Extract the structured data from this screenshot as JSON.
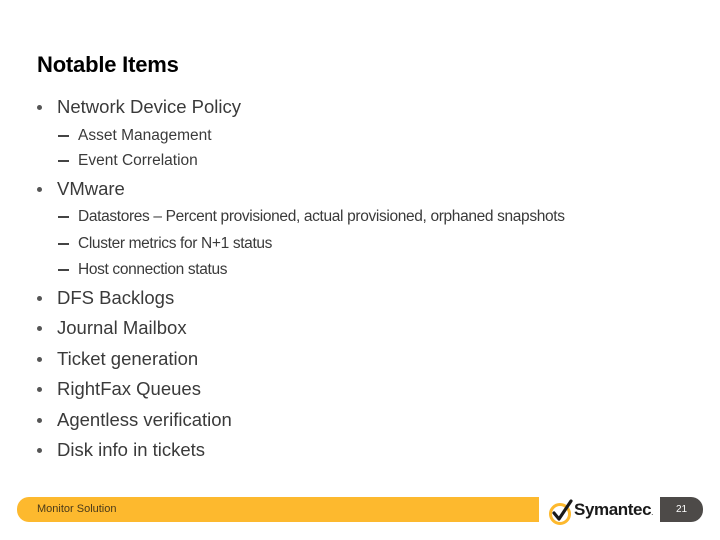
{
  "slide": {
    "title": "Notable Items",
    "items": [
      {
        "label": "Network Device Policy",
        "subitems": [
          "Asset Management",
          "Event Correlation"
        ]
      },
      {
        "label": "VMware",
        "subitems": [
          "Datastores – Percent provisioned, actual provisioned, orphaned snapshots",
          "Cluster metrics for N+1 status",
          "Host connection status"
        ]
      },
      {
        "label": "DFS Backlogs",
        "subitems": []
      },
      {
        "label": "Journal Mailbox",
        "subitems": []
      },
      {
        "label": "Ticket generation",
        "subitems": []
      },
      {
        "label": "RightFax Queues",
        "subitems": []
      },
      {
        "label": "Agentless verification",
        "subitems": []
      },
      {
        "label": "Disk info in tickets",
        "subitems": []
      }
    ]
  },
  "footer": {
    "label": "Monitor Solution",
    "logo_text": "Symantec",
    "logo_icon": "checkmark-circle-icon",
    "page_number": "21"
  },
  "colors": {
    "footer_bar": "#fdb92e",
    "page_box": "#4d4a48",
    "logo_accent": "#fdb92e"
  }
}
